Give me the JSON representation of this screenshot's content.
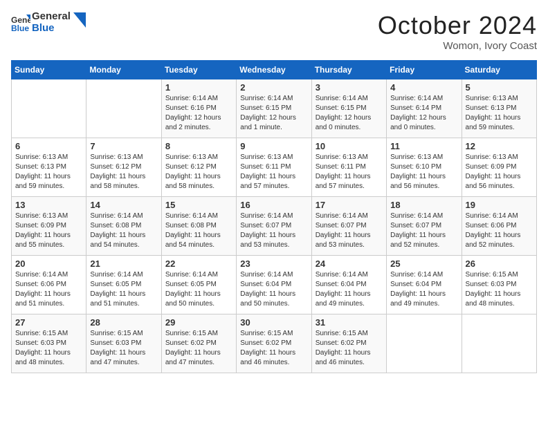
{
  "header": {
    "logo_line1": "General",
    "logo_line2": "Blue",
    "month": "October 2024",
    "location": "Womon, Ivory Coast"
  },
  "days_of_week": [
    "Sunday",
    "Monday",
    "Tuesday",
    "Wednesday",
    "Thursday",
    "Friday",
    "Saturday"
  ],
  "weeks": [
    [
      {
        "day": "",
        "info": ""
      },
      {
        "day": "",
        "info": ""
      },
      {
        "day": "1",
        "info": "Sunrise: 6:14 AM\nSunset: 6:16 PM\nDaylight: 12 hours and 2 minutes."
      },
      {
        "day": "2",
        "info": "Sunrise: 6:14 AM\nSunset: 6:15 PM\nDaylight: 12 hours and 1 minute."
      },
      {
        "day": "3",
        "info": "Sunrise: 6:14 AM\nSunset: 6:15 PM\nDaylight: 12 hours and 0 minutes."
      },
      {
        "day": "4",
        "info": "Sunrise: 6:14 AM\nSunset: 6:14 PM\nDaylight: 12 hours and 0 minutes."
      },
      {
        "day": "5",
        "info": "Sunrise: 6:13 AM\nSunset: 6:13 PM\nDaylight: 11 hours and 59 minutes."
      }
    ],
    [
      {
        "day": "6",
        "info": "Sunrise: 6:13 AM\nSunset: 6:13 PM\nDaylight: 11 hours and 59 minutes."
      },
      {
        "day": "7",
        "info": "Sunrise: 6:13 AM\nSunset: 6:12 PM\nDaylight: 11 hours and 58 minutes."
      },
      {
        "day": "8",
        "info": "Sunrise: 6:13 AM\nSunset: 6:12 PM\nDaylight: 11 hours and 58 minutes."
      },
      {
        "day": "9",
        "info": "Sunrise: 6:13 AM\nSunset: 6:11 PM\nDaylight: 11 hours and 57 minutes."
      },
      {
        "day": "10",
        "info": "Sunrise: 6:13 AM\nSunset: 6:11 PM\nDaylight: 11 hours and 57 minutes."
      },
      {
        "day": "11",
        "info": "Sunrise: 6:13 AM\nSunset: 6:10 PM\nDaylight: 11 hours and 56 minutes."
      },
      {
        "day": "12",
        "info": "Sunrise: 6:13 AM\nSunset: 6:09 PM\nDaylight: 11 hours and 56 minutes."
      }
    ],
    [
      {
        "day": "13",
        "info": "Sunrise: 6:13 AM\nSunset: 6:09 PM\nDaylight: 11 hours and 55 minutes."
      },
      {
        "day": "14",
        "info": "Sunrise: 6:14 AM\nSunset: 6:08 PM\nDaylight: 11 hours and 54 minutes."
      },
      {
        "day": "15",
        "info": "Sunrise: 6:14 AM\nSunset: 6:08 PM\nDaylight: 11 hours and 54 minutes."
      },
      {
        "day": "16",
        "info": "Sunrise: 6:14 AM\nSunset: 6:07 PM\nDaylight: 11 hours and 53 minutes."
      },
      {
        "day": "17",
        "info": "Sunrise: 6:14 AM\nSunset: 6:07 PM\nDaylight: 11 hours and 53 minutes."
      },
      {
        "day": "18",
        "info": "Sunrise: 6:14 AM\nSunset: 6:07 PM\nDaylight: 11 hours and 52 minutes."
      },
      {
        "day": "19",
        "info": "Sunrise: 6:14 AM\nSunset: 6:06 PM\nDaylight: 11 hours and 52 minutes."
      }
    ],
    [
      {
        "day": "20",
        "info": "Sunrise: 6:14 AM\nSunset: 6:06 PM\nDaylight: 11 hours and 51 minutes."
      },
      {
        "day": "21",
        "info": "Sunrise: 6:14 AM\nSunset: 6:05 PM\nDaylight: 11 hours and 51 minutes."
      },
      {
        "day": "22",
        "info": "Sunrise: 6:14 AM\nSunset: 6:05 PM\nDaylight: 11 hours and 50 minutes."
      },
      {
        "day": "23",
        "info": "Sunrise: 6:14 AM\nSunset: 6:04 PM\nDaylight: 11 hours and 50 minutes."
      },
      {
        "day": "24",
        "info": "Sunrise: 6:14 AM\nSunset: 6:04 PM\nDaylight: 11 hours and 49 minutes."
      },
      {
        "day": "25",
        "info": "Sunrise: 6:14 AM\nSunset: 6:04 PM\nDaylight: 11 hours and 49 minutes."
      },
      {
        "day": "26",
        "info": "Sunrise: 6:15 AM\nSunset: 6:03 PM\nDaylight: 11 hours and 48 minutes."
      }
    ],
    [
      {
        "day": "27",
        "info": "Sunrise: 6:15 AM\nSunset: 6:03 PM\nDaylight: 11 hours and 48 minutes."
      },
      {
        "day": "28",
        "info": "Sunrise: 6:15 AM\nSunset: 6:03 PM\nDaylight: 11 hours and 47 minutes."
      },
      {
        "day": "29",
        "info": "Sunrise: 6:15 AM\nSunset: 6:02 PM\nDaylight: 11 hours and 47 minutes."
      },
      {
        "day": "30",
        "info": "Sunrise: 6:15 AM\nSunset: 6:02 PM\nDaylight: 11 hours and 46 minutes."
      },
      {
        "day": "31",
        "info": "Sunrise: 6:15 AM\nSunset: 6:02 PM\nDaylight: 11 hours and 46 minutes."
      },
      {
        "day": "",
        "info": ""
      },
      {
        "day": "",
        "info": ""
      }
    ]
  ]
}
